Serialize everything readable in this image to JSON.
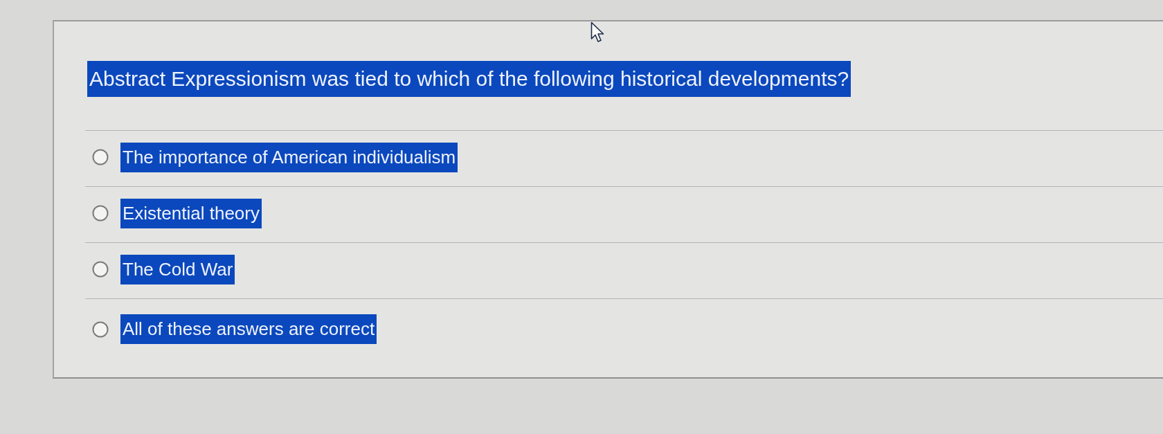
{
  "question": {
    "text": "Abstract Expressionism was tied to which of the following historical developments?",
    "highlighted": true
  },
  "options": [
    {
      "label": "The importance of American individualism",
      "selected": false,
      "highlighted": true
    },
    {
      "label": "Existential theory",
      "selected": false,
      "highlighted": true
    },
    {
      "label": "The Cold War",
      "selected": false,
      "highlighted": true
    },
    {
      "label": "All of these answers are correct",
      "selected": false,
      "highlighted": true
    }
  ]
}
